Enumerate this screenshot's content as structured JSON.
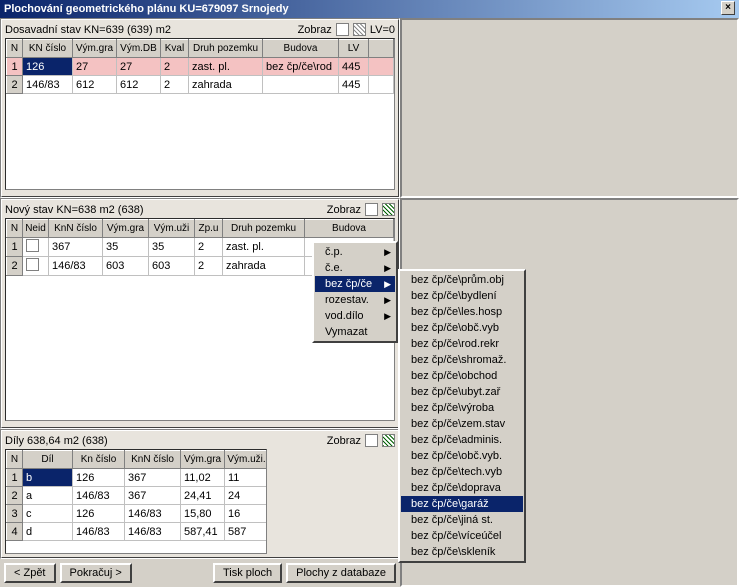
{
  "title": "Plochování geometrického plánu KU=679097  Srnojedy",
  "section1": {
    "label": "Dosavadní stav KN=639 (639) m2",
    "zobraz": "Zobraz",
    "lv": "LV=0",
    "cols": [
      "N",
      "KN číslo",
      "Vým.gra",
      "Vým.DB",
      "Kval",
      "Druh pozemku",
      "Budova",
      "LV",
      ""
    ],
    "rows": [
      {
        "n": "1",
        "kn": "126",
        "gra": "27",
        "db": "27",
        "kval": "2",
        "druh": "zast. pl.",
        "bud": "bez čp/če\\rod",
        "lv": "445"
      },
      {
        "n": "2",
        "kn": "146/83",
        "gra": "612",
        "db": "612",
        "kval": "2",
        "druh": "zahrada",
        "bud": "",
        "lv": "445"
      }
    ]
  },
  "section2": {
    "label": "Nový stav KN=638 m2 (638)",
    "zobraz": "Zobraz",
    "cols": [
      "N",
      "Neid",
      "KnN číslo",
      "Vým.gra",
      "Vým.uži",
      "Zp.u",
      "Druh pozemku",
      "Budova"
    ],
    "rows": [
      {
        "n": "1",
        "neid": "",
        "kn": "367",
        "gra": "35",
        "uzi": "35",
        "zp": "2",
        "druh": "zast. pl.",
        "bud": ""
      },
      {
        "n": "2",
        "neid": "",
        "kn": "146/83",
        "gra": "603",
        "uzi": "603",
        "zp": "2",
        "druh": "zahrada",
        "bud": ""
      }
    ]
  },
  "section3": {
    "label": "Díly   638,64 m2 (638)",
    "zobraz": "Zobraz",
    "cols": [
      "N",
      "Díl",
      "Kn číslo",
      "KnN číslo",
      "Vým.gra",
      "Vým.uži."
    ],
    "rows": [
      {
        "n": "1",
        "dil": "b",
        "kn": "126",
        "knn": "367",
        "gra": "11,02",
        "uzi": "11"
      },
      {
        "n": "2",
        "dil": "a",
        "kn": "146/83",
        "knn": "367",
        "gra": "24,41",
        "uzi": "24"
      },
      {
        "n": "3",
        "dil": "c",
        "kn": "126",
        "knn": "146/83",
        "gra": "15,80",
        "uzi": "16"
      },
      {
        "n": "4",
        "dil": "d",
        "kn": "146/83",
        "knn": "146/83",
        "gra": "587,41",
        "uzi": "587"
      }
    ]
  },
  "menu1": {
    "items": [
      {
        "label": "č.p.",
        "arrow": true
      },
      {
        "label": "č.e.",
        "arrow": true
      },
      {
        "label": "bez čp/če",
        "arrow": true,
        "hl": true
      },
      {
        "label": "rozestav.",
        "arrow": true
      },
      {
        "label": "vod.dílo",
        "arrow": true
      },
      {
        "label": "Vymazat",
        "arrow": false
      }
    ]
  },
  "menu2": {
    "items": [
      "bez čp/če\\prům.obj",
      "bez čp/če\\bydlení",
      "bez čp/če\\les.hosp",
      "bez čp/če\\obč.vyb",
      "bez čp/če\\rod.rekr",
      "bez čp/če\\shromaž.",
      "bez čp/če\\obchod",
      "bez čp/če\\ubyt.zař",
      "bez čp/če\\výroba",
      "bez čp/če\\zem.stav",
      "bez čp/če\\adminis.",
      "bez čp/če\\obč.vyb.",
      "bez čp/če\\tech.vyb",
      "bez čp/če\\doprava",
      "bez čp/če\\garáž",
      "bez čp/če\\jiná st.",
      "bez čp/če\\víceúčel",
      "bez čp/če\\skleník"
    ],
    "hl_index": 14
  },
  "buttons": {
    "zpet": "< Zpět",
    "pokracuj": "Pokračuj >",
    "tisk": "Tisk ploch",
    "plochy": "Plochy z databaze"
  }
}
